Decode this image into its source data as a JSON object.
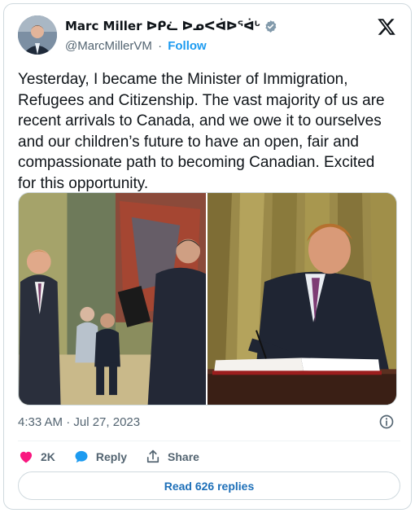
{
  "author": {
    "display_name": "Marc Miller ᐅᑭᓛ ᐅᓄᐸᐋᐅᕐᐋᒡ",
    "handle": "@MarcMillerVM",
    "separator": "·",
    "follow_label": "Follow",
    "verified": true
  },
  "post": {
    "text": "Yesterday, I became the Minister of Immigration,\nRefugees and Citizenship. The vast majority of us are\nrecent arrivals to Canada, and we owe it to ourselves\nand our children’s future to have an open, fair and\ncompassionate path to becoming Canadian. Excited\nfor this opportunity.",
    "timestamp": "4:33 AM · Jul 27, 2023"
  },
  "media": {
    "photos": [
      {
        "name": "swearing-in-ceremony-photo"
      },
      {
        "name": "signing-document-photo"
      }
    ]
  },
  "actions": {
    "like_count": "2K",
    "reply_label": "Reply",
    "share_label": "Share"
  },
  "replies": {
    "read_label": "Read 626 replies"
  },
  "colors": {
    "accent": "#1d9bf0",
    "like": "#f91880",
    "text_secondary": "#536471",
    "border": "#cfd9de"
  },
  "icons": {
    "verified": "verified-badge-icon",
    "brand": "x-logo-icon",
    "info": "info-icon",
    "like": "heart-icon",
    "reply": "speech-bubble-icon",
    "share": "share-icon"
  }
}
